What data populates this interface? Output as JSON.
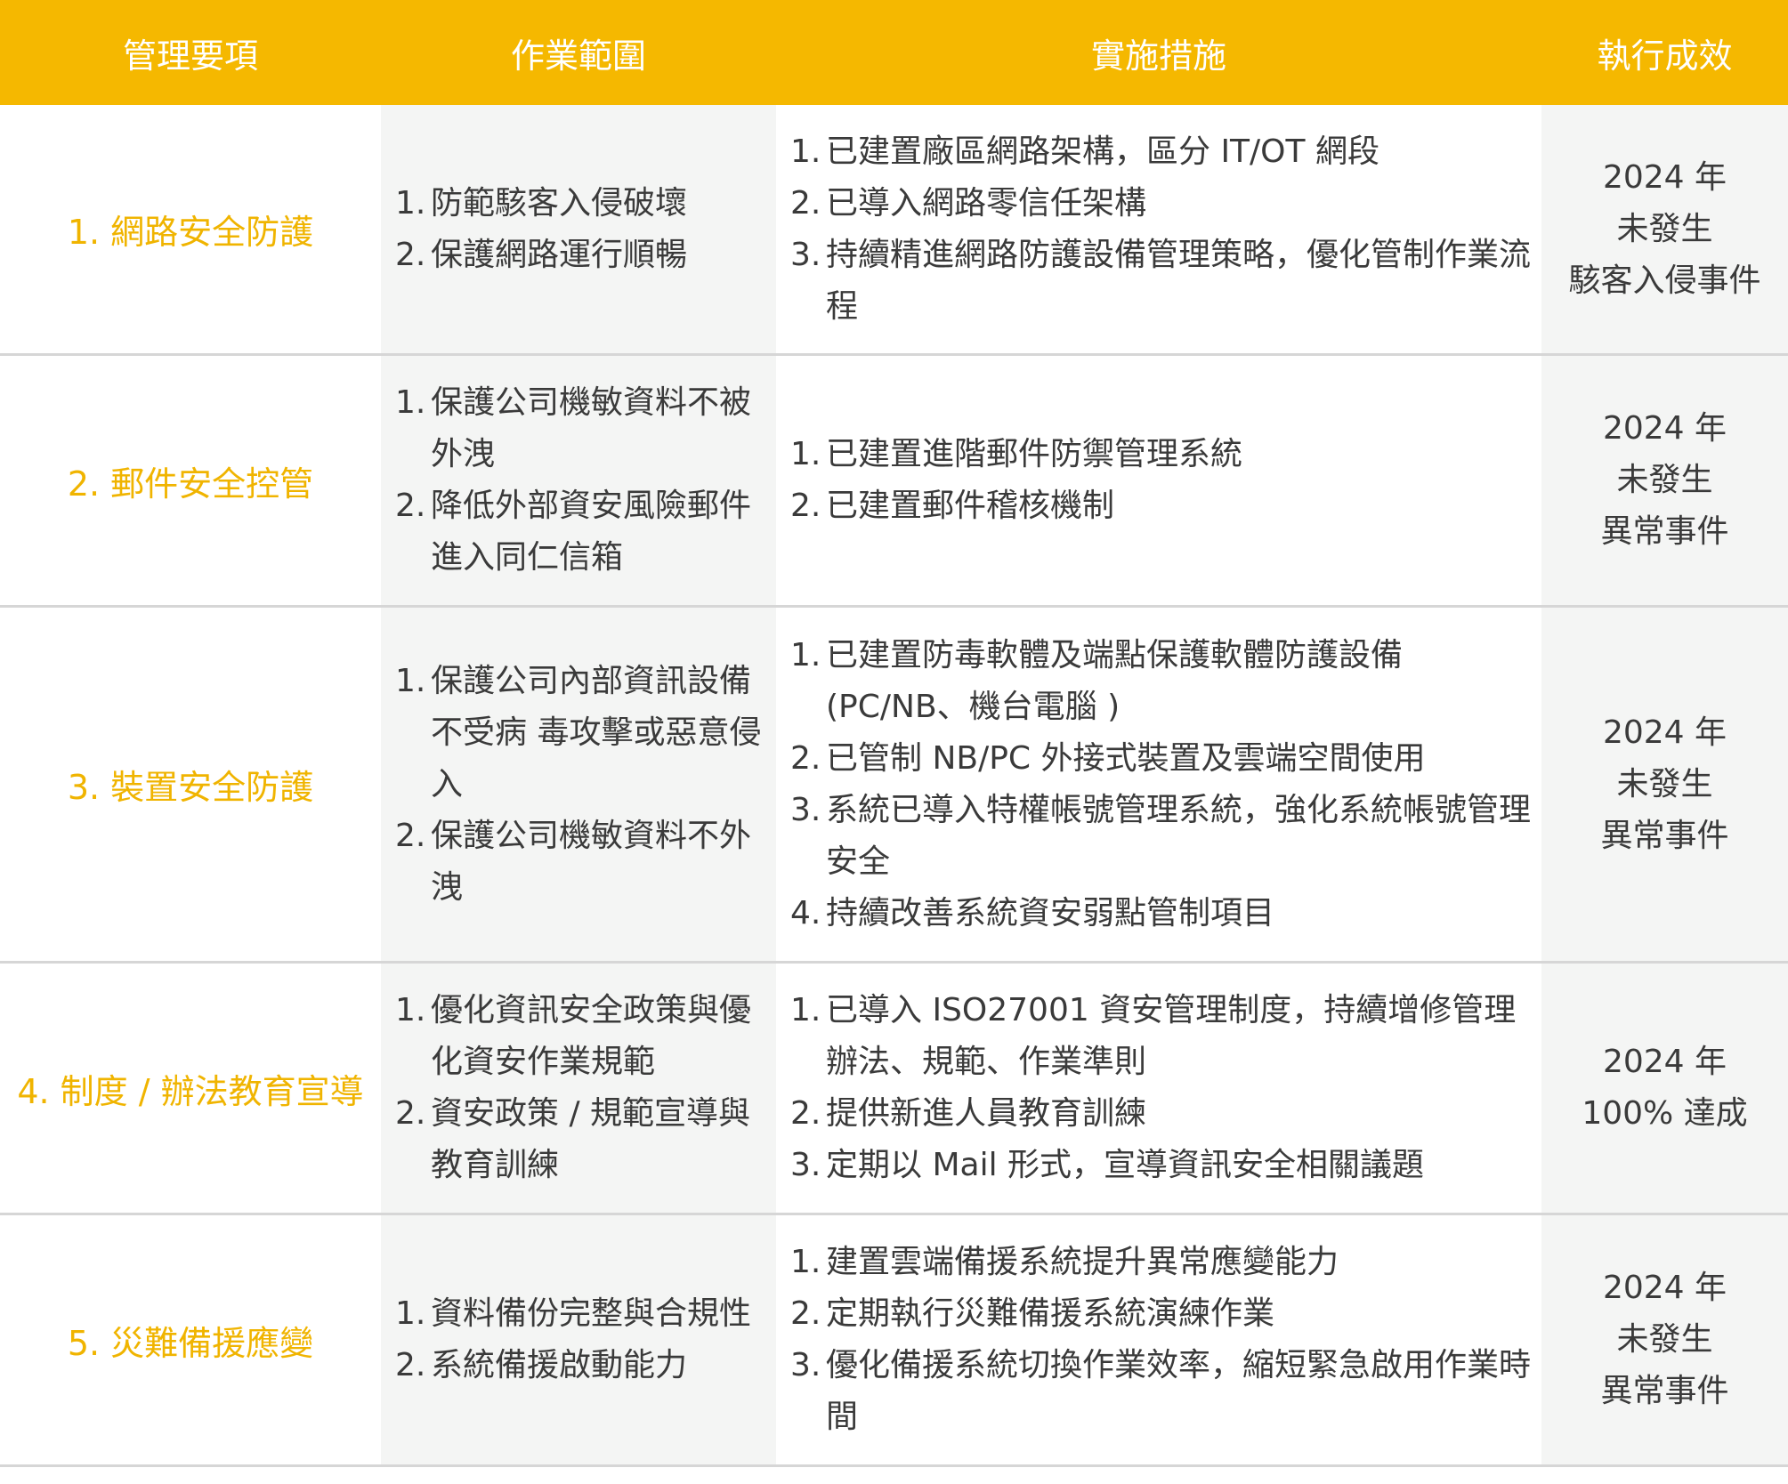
{
  "headers": [
    "管理要項",
    "作業範圍",
    "實施措施",
    "執行成效"
  ],
  "rows": [
    {
      "item": "1. 網路安全防護",
      "scope": [
        {
          "n": "1.",
          "t": "防範駭客入侵破壞"
        },
        {
          "n": "2.",
          "t": "保護網路運行順暢"
        }
      ],
      "measures": [
        {
          "n": "1.",
          "t": "已建置廠區網路架構，區分 IT/OT 網段"
        },
        {
          "n": "2.",
          "t": "已導入網路零信任架構"
        },
        {
          "n": "3.",
          "t": "持續精進網路防護設備管理策略，優化管制作業流程"
        }
      ],
      "result": [
        "2024 年",
        "未發生",
        "駭客入侵事件"
      ]
    },
    {
      "item": "2. 郵件安全控管",
      "scope": [
        {
          "n": "1.",
          "t": "保護公司機敏資料不被外洩"
        },
        {
          "n": "2.",
          "t": "降低外部資安風險郵件進入同仁信箱"
        }
      ],
      "measures": [
        {
          "n": "1.",
          "t": "已建置進階郵件防禦管理系統"
        },
        {
          "n": "2.",
          "t": "已建置郵件稽核機制"
        }
      ],
      "result": [
        "2024 年",
        "未發生",
        "異常事件"
      ]
    },
    {
      "item": "3. 裝置安全防護",
      "scope": [
        {
          "n": "1.",
          "t": "保護公司內部資訊設備不受病 毒攻擊或惡意侵入"
        },
        {
          "n": "2.",
          "t": "保護公司機敏資料不外洩"
        }
      ],
      "measures": [
        {
          "n": "1.",
          "t": "已建置防毒軟體及端點保護軟體防護設備 (PC/NB、機台電腦 )"
        },
        {
          "n": "2.",
          "t": "已管制 NB/PC 外接式裝置及雲端空間使用"
        },
        {
          "n": "3.",
          "t": "系統已導入特權帳號管理系統，強化系統帳號管理安全"
        },
        {
          "n": "4.",
          "t": "持續改善系統資安弱點管制項目"
        }
      ],
      "result": [
        "2024 年",
        "未發生",
        "異常事件"
      ]
    },
    {
      "item": "4. 制度 / 辦法教育宣導",
      "scope": [
        {
          "n": "1.",
          "t": "優化資訊安全政策與優化資安作業規範"
        },
        {
          "n": "2.",
          "t": "資安政策 / 規範宣導與教育訓練"
        }
      ],
      "measures": [
        {
          "n": "1.",
          "t": "已導入 ISO27001 資安管理制度，持續增修管理辦法、規範、作業準則"
        },
        {
          "n": "2.",
          "t": "提供新進人員教育訓練"
        },
        {
          "n": "3.",
          "t": "定期以 Mail 形式，宣導資訊安全相關議題"
        }
      ],
      "result": [
        "2024 年",
        "100% 達成"
      ]
    },
    {
      "item": "5. 災難備援應變",
      "scope": [
        {
          "n": "1.",
          "t": "資料備份完整與合規性"
        },
        {
          "n": "2.",
          "t": "系統備援啟動能力"
        }
      ],
      "measures": [
        {
          "n": "1.",
          "t": "建置雲端備援系統提升異常應變能力"
        },
        {
          "n": "2.",
          "t": "定期執行災難備援系統演練作業"
        },
        {
          "n": "3.",
          "t": "優化備援系統切換作業效率，縮短緊急啟用作業時間"
        }
      ],
      "result": [
        "2024 年",
        "未發生",
        "異常事件"
      ]
    }
  ],
  "colors": {
    "header_bg": "#f5b800",
    "item_text": "#f0b400",
    "shaded_bg": "#f4f5f4",
    "border": "#d6d6d6"
  }
}
